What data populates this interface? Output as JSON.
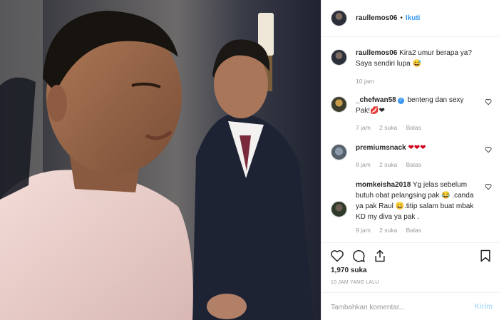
{
  "post": {
    "username": "raullemos06",
    "separator": "•",
    "follow_label": "Ikuti",
    "caption": {
      "username": "raullemos06",
      "text": "Kira2 umur berapa ya? Saya sendiri lupa 😅",
      "time": "10 jam"
    },
    "comments": [
      {
        "username": "_chefwan58",
        "verified": true,
        "text": "benteng dan sexy Pak!💋❤",
        "time": "7 jam",
        "likes": "2 suka",
        "reply": "Balas"
      },
      {
        "username": "premiumsnack",
        "verified": false,
        "text": "❤❤❤",
        "time": "8 jam",
        "likes": "2 suka",
        "reply": "Balas"
      },
      {
        "username": "momkeisha2018",
        "verified": false,
        "text": "Yg jelas sebelum butuh obat pelangsing pak 😂 .canda ya pak Raul 😀.titip salam buat mbak KD my diva ya pak .",
        "time": "9 jam",
        "likes": "2 suka",
        "reply": "Balas"
      }
    ],
    "likes_count": "1,970 suka",
    "time_ago": "10 JAM YANG LALU",
    "comment_placeholder": "Tambahkan komentar...",
    "post_button": "Kirim"
  },
  "icons": [
    "heart-icon",
    "comment-icon",
    "share-icon",
    "bookmark-icon",
    "verified-badge-icon"
  ],
  "colors": {
    "link": "#3897f0",
    "muted": "#999999",
    "text": "#262626",
    "border": "#efefef",
    "post_disabled": "#b2dffc"
  }
}
